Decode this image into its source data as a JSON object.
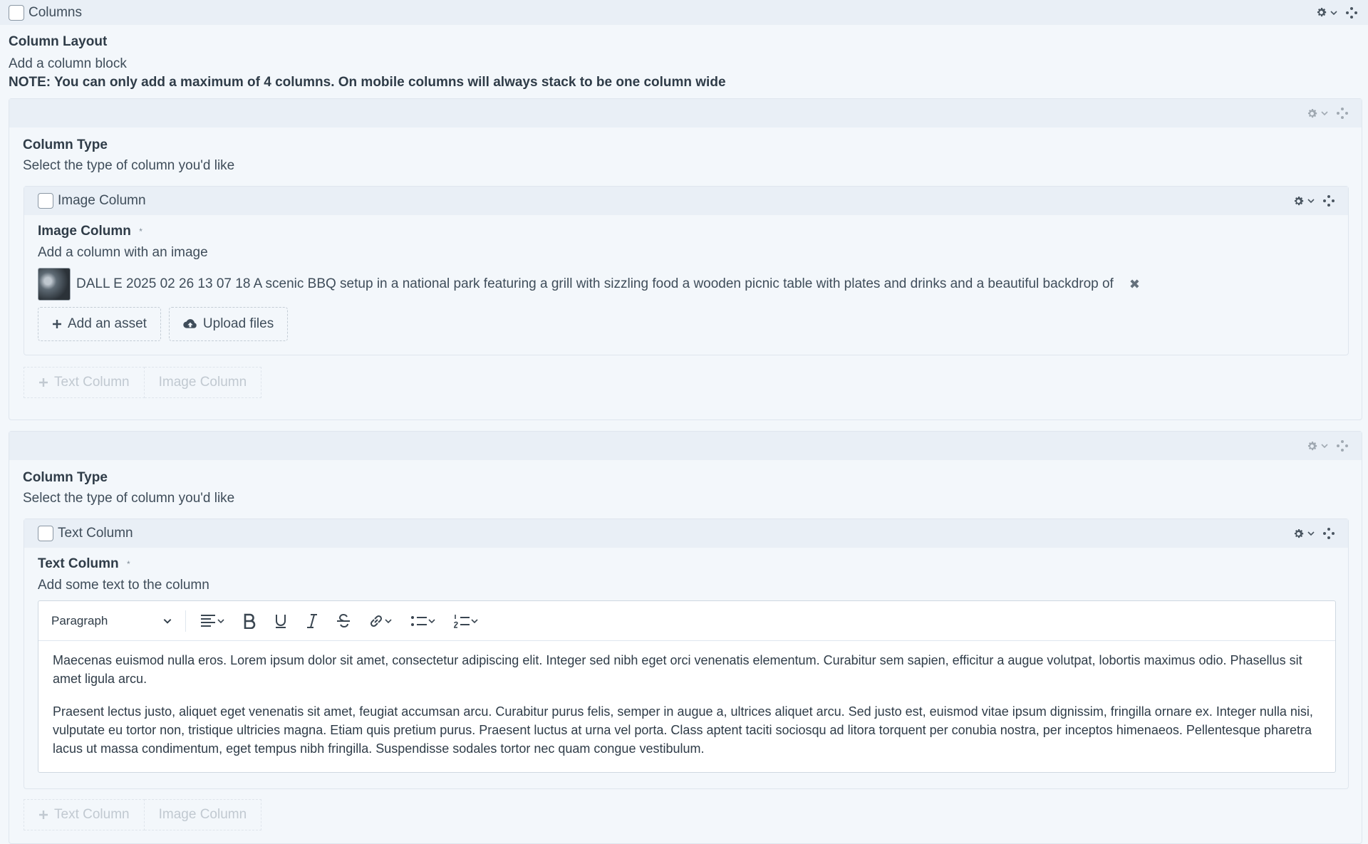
{
  "root": {
    "title": "Columns",
    "label": "Column Layout",
    "desc": "Add a column block",
    "note": "NOTE: You can only add a maximum of 4 columns. On mobile columns will always stack to be one column wide"
  },
  "blocks": [
    {
      "field_label": "Column Type",
      "field_desc": "Select the type of column you'd like",
      "inner_title": "Image Column",
      "inner_label": "Image Column",
      "required_mark": "*",
      "inner_desc": "Add a column with an image",
      "asset_name": "DALL E 2025 02 26 13 07 18 A scenic BBQ setup in a national park featuring a grill with sizzling food a wooden picnic table with plates and drinks and a beautiful backdrop of",
      "remove_glyph": "✖",
      "add_asset_label": "Add an asset",
      "upload_label": "Upload files",
      "add_text_column": "Text Column",
      "add_image_column": "Image Column"
    },
    {
      "field_label": "Column Type",
      "field_desc": "Select the type of column you'd like",
      "inner_title": "Text Column",
      "inner_label": "Text Column",
      "required_mark": "*",
      "inner_desc": "Add some text to the column",
      "format_select": "Paragraph",
      "paragraphs": [
        "Maecenas euismod nulla eros. Lorem ipsum dolor sit amet, consectetur adipiscing elit. Integer sed nibh eget orci venenatis elementum. Curabitur sem sapien, efficitur a augue volutpat, lobortis maximus odio. Phasellus sit amet ligula arcu.",
        "Praesent lectus justo, aliquet eget venenatis sit amet, feugiat accumsan arcu. Curabitur purus felis, semper in augue a, ultrices aliquet arcu. Sed justo est, euismod vitae ipsum dignissim, fringilla ornare ex. Integer nulla nisi, vulputate eu tortor non, tristique ultricies magna. Etiam quis pretium purus. Praesent luctus at urna vel porta. Class aptent taciti sociosqu ad litora torquent per conubia nostra, per inceptos himenaeos. Pellentesque pharetra lacus ut massa condimentum, eget tempus nibh fringilla. Suspendisse sodales tortor nec quam congue vestibulum."
      ],
      "add_text_column": "Text Column",
      "add_image_column": "Image Column"
    }
  ],
  "icons": {
    "gear": "gear-icon",
    "caret": "chevron-down-icon",
    "move": "move-icon",
    "plus": "plus-icon",
    "cloud": "cloud-upload-icon",
    "remove": "remove-icon"
  },
  "colors": {
    "background": "#f3f7fb",
    "header": "#e9eff6",
    "border": "#dfe6ee",
    "text": "#3f4d5a",
    "muted": "#c1c9d1"
  }
}
